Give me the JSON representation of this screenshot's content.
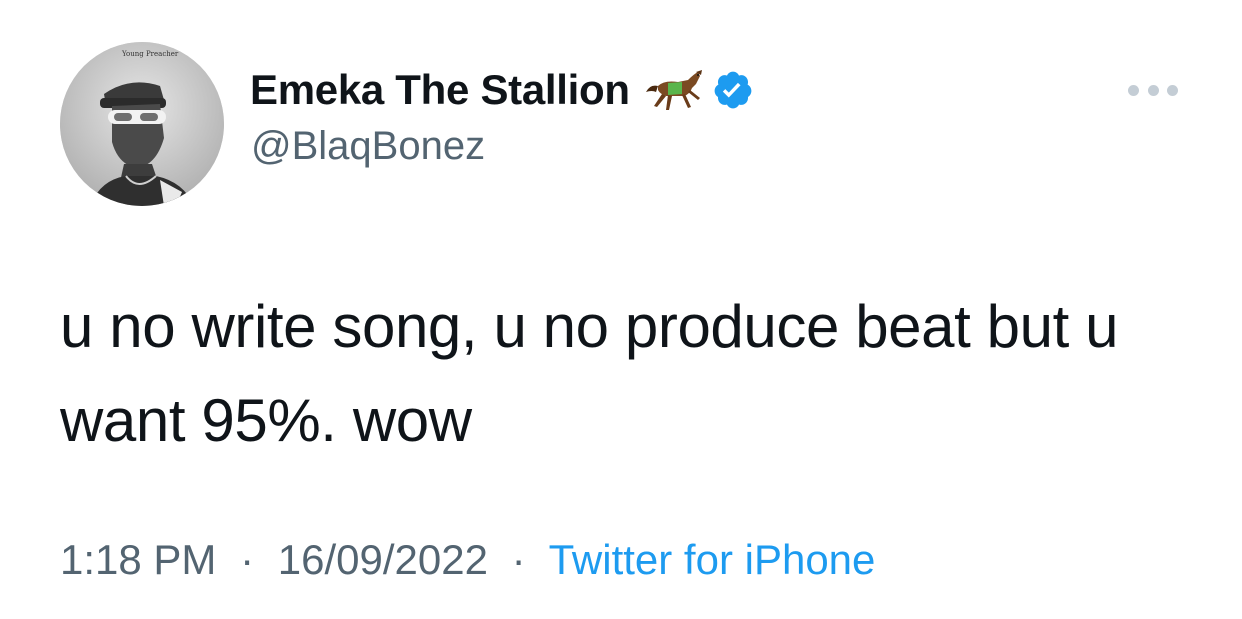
{
  "author": {
    "display_name": "Emeka The Stallion",
    "handle": "@BlaqBonez",
    "name_emoji_icon": "horse-icon",
    "verified_icon": "verified-badge-icon",
    "avatar_caption": "Young Preacher"
  },
  "tweet": {
    "text": "u no write song, u no produce beat but u want 95%. wow",
    "time": "1:18 PM",
    "separator": "·",
    "date": "16/09/2022",
    "source": "Twitter for iPhone"
  },
  "actions": {
    "more_icon": "more-horizontal-icon"
  },
  "colors": {
    "text_primary": "#0f1419",
    "text_secondary": "#536471",
    "link_blue": "#1d9bf0",
    "verified_blue": "#1d9bf0",
    "more_dots": "#c4cdd5"
  }
}
